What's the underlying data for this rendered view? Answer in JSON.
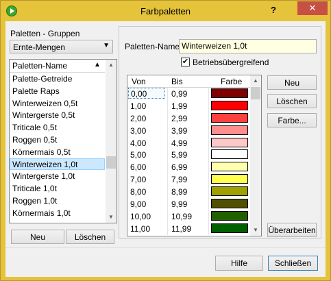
{
  "window": {
    "title": "Farbpaletten",
    "help_label": "?",
    "close_label": "✕",
    "colors": {
      "frame": "#e5c33a",
      "close": "#c74f44"
    }
  },
  "groups": {
    "label": "Paletten - Gruppen",
    "selected": "Ernte-Mengen"
  },
  "palette_list": {
    "header": "Paletten-Name",
    "items": [
      "Palette-Getreide",
      "Palette Raps",
      "Winterweizen 0,5t",
      "Wintergerste 0,5t",
      "Triticale 0,5t",
      "Roggen 0,5t",
      "Körnermais 0,5t",
      "Winterweizen 1,0t",
      "Wintergerste 1,0t",
      "Triticale 1,0t",
      "Roggen 1,0t",
      "Körnermais 1,0t"
    ],
    "selected_index": 7,
    "new_label": "Neu",
    "delete_label": "Löschen"
  },
  "editor": {
    "name_label": "Paletten-Name",
    "name_value": "Winterweizen 1,0t",
    "cross_label": "Betriebsübergreifend",
    "cross_checked": true,
    "table": {
      "headers": [
        "Von",
        "Bis",
        "Farbe"
      ],
      "rows": [
        {
          "from": "0,00",
          "to": "0,99",
          "color": "#800000"
        },
        {
          "from": "1,00",
          "to": "1,99",
          "color": "#ff0000"
        },
        {
          "from": "2,00",
          "to": "2,99",
          "color": "#ff4040"
        },
        {
          "from": "3,00",
          "to": "3,99",
          "color": "#ff8f8f"
        },
        {
          "from": "4,00",
          "to": "4,99",
          "color": "#ffc8c8"
        },
        {
          "from": "5,00",
          "to": "5,99",
          "color": "#ffffff"
        },
        {
          "from": "6,00",
          "to": "6,99",
          "color": "#ffffb0"
        },
        {
          "from": "7,00",
          "to": "7,99",
          "color": "#ffff50"
        },
        {
          "from": "8,00",
          "to": "8,99",
          "color": "#a0a000"
        },
        {
          "from": "9,00",
          "to": "9,99",
          "color": "#505000"
        },
        {
          "from": "10,00",
          "to": "10,99",
          "color": "#206000"
        },
        {
          "from": "11,00",
          "to": "11,99",
          "color": "#006000"
        }
      ]
    },
    "buttons": {
      "new": "Neu",
      "delete": "Löschen",
      "color": "Farbe...",
      "revise": "Überarbeiten"
    }
  },
  "footer": {
    "help": "Hilfe",
    "close": "Schließen"
  }
}
